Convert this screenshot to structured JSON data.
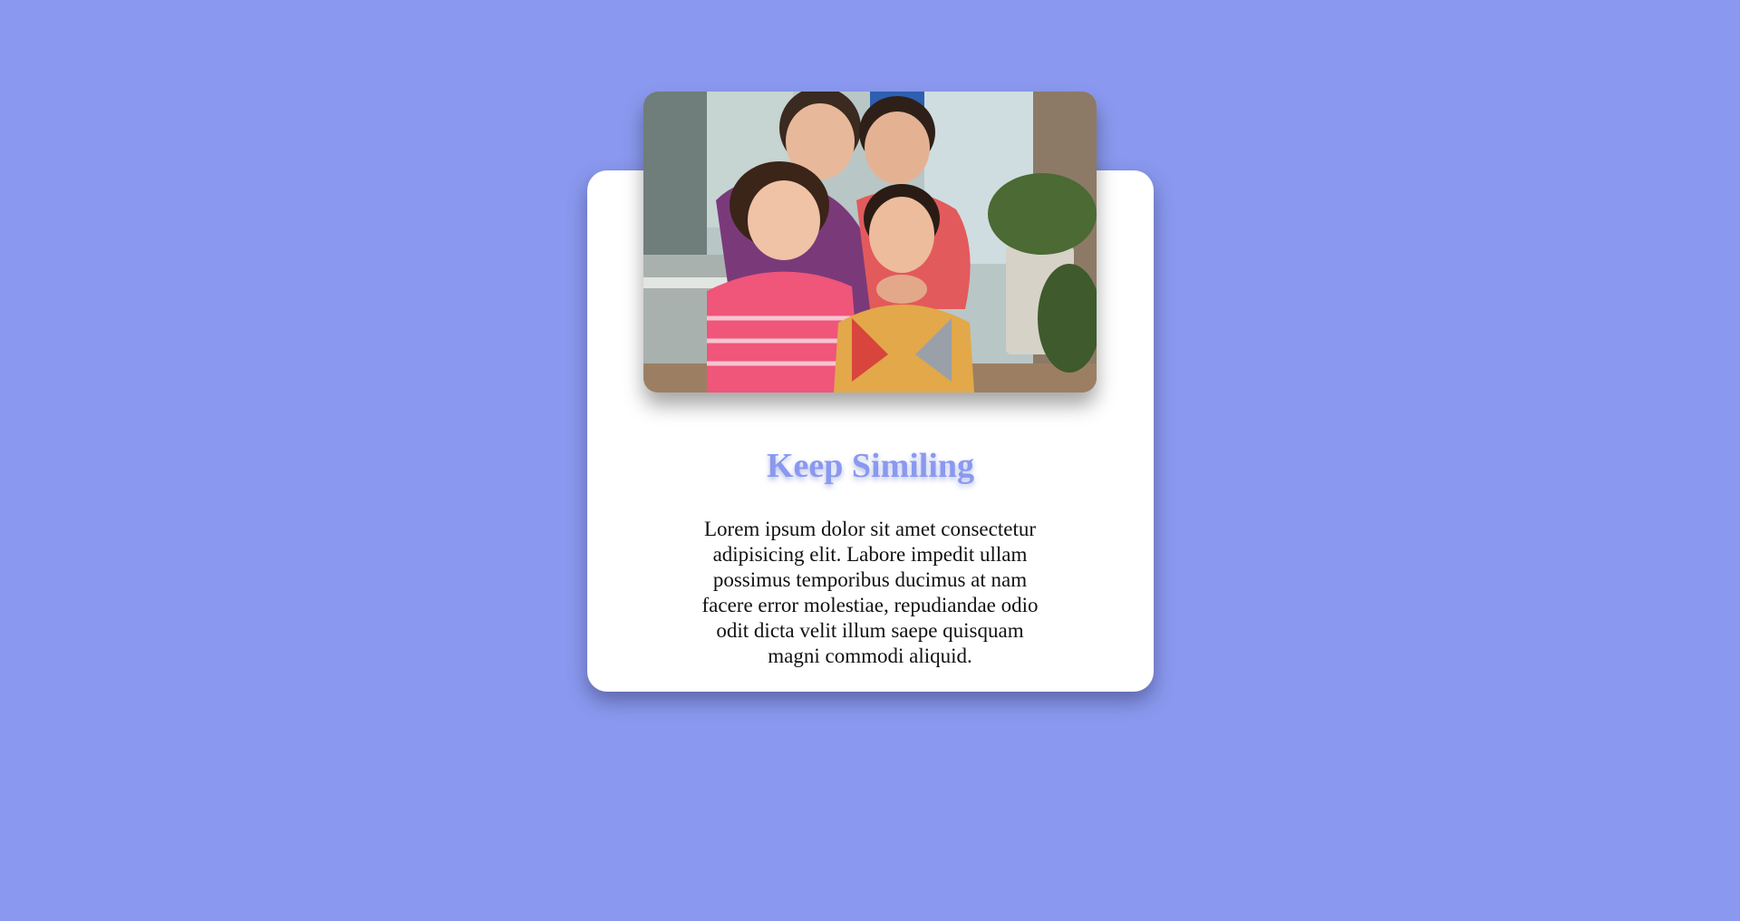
{
  "page": {
    "background_color": "#8a99ef",
    "accent_color": "#8a99ef",
    "card_color": "#ffffff"
  },
  "card": {
    "image_alt": "Four smiling children posing outdoors, two making peace signs",
    "title": "Keep Similing",
    "text": "Lorem ipsum dolor sit amet consectetur adipisicing elit. Labore impedit ullam possimus temporibus ducimus at nam facere error molestiae, repudiandae odio odit dicta velit illum saepe quisquam magni commodi aliquid."
  }
}
